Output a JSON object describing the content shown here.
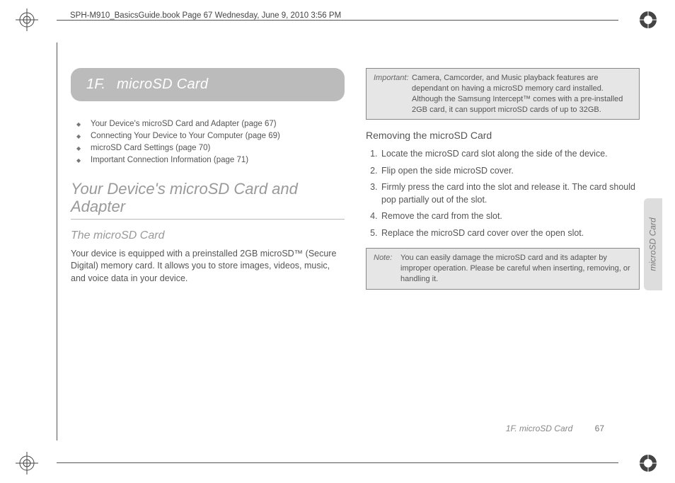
{
  "meta": {
    "header": "SPH-M910_BasicsGuide.book  Page 67  Wednesday, June 9, 2010  3:56 PM"
  },
  "chapter": {
    "number": "1F.",
    "title": "microSD Card"
  },
  "toc": [
    "Your Device's microSD Card and Adapter (page 67)",
    "Connecting Your Device to Your Computer (page 69)",
    "microSD Card Settings (page 70)",
    "Important Connection Information (page 71)"
  ],
  "left": {
    "section_title": "Your Device's microSD Card and Adapter",
    "subsection_title": "The microSD Card",
    "body": "Your device is equipped with a preinstalled 2GB microSD™ (Secure Digital) memory card. It allows you to store images, videos, music, and voice data in your device."
  },
  "right": {
    "important_label": "Important:",
    "important_text": "Camera, Camcorder, and Music playback features are dependant on having a microSD memory card installed. Although the Samsung Intercept™ comes with a pre-installed 2GB card, it can support microSD cards of up to 32GB.",
    "heading": "Removing the microSD Card",
    "steps": [
      "Locate the microSD card slot along the side of the device.",
      "Flip open the side microSD cover.",
      "Firmly press the card into the slot and release it. The card should pop partially out of the slot.",
      "Remove the card from the slot.",
      "Replace the microSD card cover over the open slot."
    ],
    "note_label": "Note:",
    "note_text": "You can easily damage the microSD card and its adapter by improper operation. Please be careful when inserting, removing, or handling it."
  },
  "side_tab": "microSD Card",
  "footer": {
    "section": "1F. microSD Card",
    "page": "67"
  }
}
